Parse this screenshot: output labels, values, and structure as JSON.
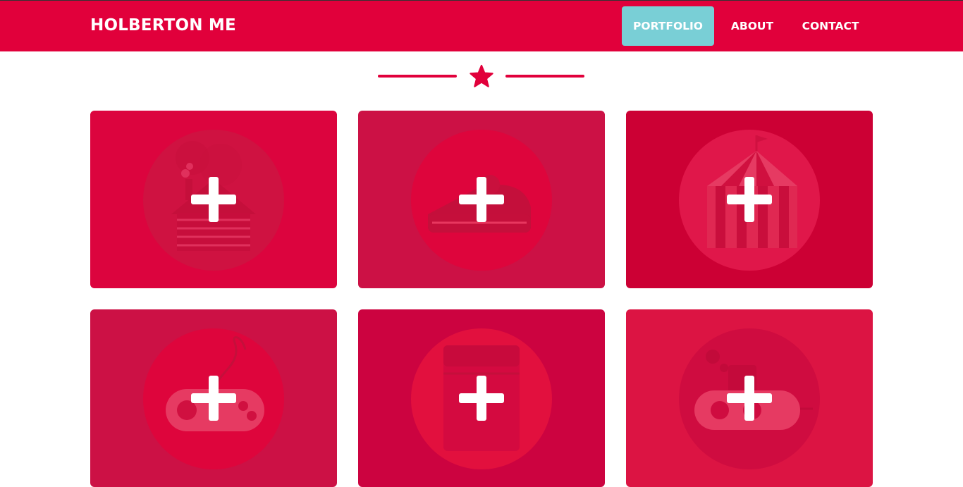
{
  "header": {
    "brand": "HOLBERTON ME",
    "nav": [
      {
        "label": "PORTFOLIO",
        "active": true
      },
      {
        "label": "ABOUT",
        "active": false
      },
      {
        "label": "CONTACT",
        "active": false
      }
    ]
  },
  "colors": {
    "primary": "#e1003b",
    "active_nav": "#79cfd6",
    "text_light": "#ffffff"
  },
  "divider": {
    "icon": "star-icon"
  },
  "portfolio": {
    "items": [
      {
        "illustration": "cabin-icon",
        "overlay_icon": "plus-icon"
      },
      {
        "illustration": "cake-icon",
        "overlay_icon": "plus-icon"
      },
      {
        "illustration": "circus-tent-icon",
        "overlay_icon": "plus-icon"
      },
      {
        "illustration": "game-controller-icon",
        "overlay_icon": "plus-icon"
      },
      {
        "illustration": "safe-icon",
        "overlay_icon": "plus-icon"
      },
      {
        "illustration": "submarine-icon",
        "overlay_icon": "plus-icon"
      }
    ]
  }
}
